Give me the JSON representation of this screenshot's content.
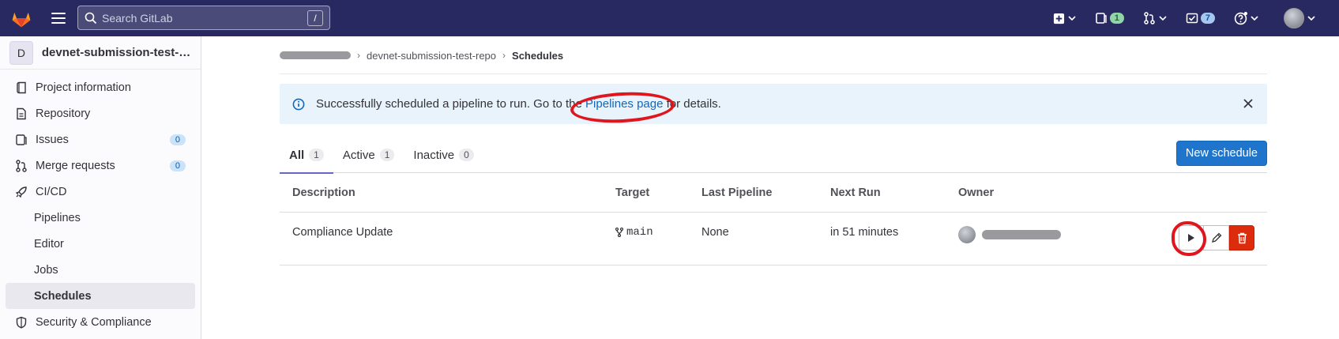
{
  "topbar": {
    "search_placeholder": "Search GitLab",
    "search_shortcut": "/",
    "issues_count": "1",
    "todos_count": "7"
  },
  "sidebar": {
    "project_initial": "D",
    "project_name": "devnet-submission-test-r...",
    "items": [
      {
        "label": "Project information",
        "icon": "info-icon"
      },
      {
        "label": "Repository",
        "icon": "doc-icon"
      },
      {
        "label": "Issues",
        "icon": "issues-icon",
        "count": "0"
      },
      {
        "label": "Merge requests",
        "icon": "merge-icon",
        "count": "0"
      },
      {
        "label": "CI/CD",
        "icon": "rocket-icon"
      },
      {
        "label": "Pipelines"
      },
      {
        "label": "Editor"
      },
      {
        "label": "Jobs"
      },
      {
        "label": "Schedules"
      },
      {
        "label": "Security & Compliance",
        "icon": "shield-icon"
      }
    ]
  },
  "breadcrumb": {
    "repo": "devnet-submission-test-repo",
    "current": "Schedules"
  },
  "alert": {
    "text_before": "Successfully scheduled a pipeline to run. Go to the ",
    "link": "Pipelines page",
    "text_after": " for details."
  },
  "tabs": [
    {
      "label": "All",
      "count": "1"
    },
    {
      "label": "Active",
      "count": "1"
    },
    {
      "label": "Inactive",
      "count": "0"
    }
  ],
  "new_schedule_label": "New schedule",
  "table": {
    "headers": [
      "Description",
      "Target",
      "Last Pipeline",
      "Next Run",
      "Owner"
    ],
    "rows": [
      {
        "description": "Compliance Update",
        "target": "main",
        "last_pipeline": "None",
        "next_run": "in 51 minutes"
      }
    ]
  },
  "colors": {
    "navbar": "#292961",
    "primary": "#1f75cb",
    "danger": "#dd2b0e",
    "annotation": "#e0161e"
  }
}
